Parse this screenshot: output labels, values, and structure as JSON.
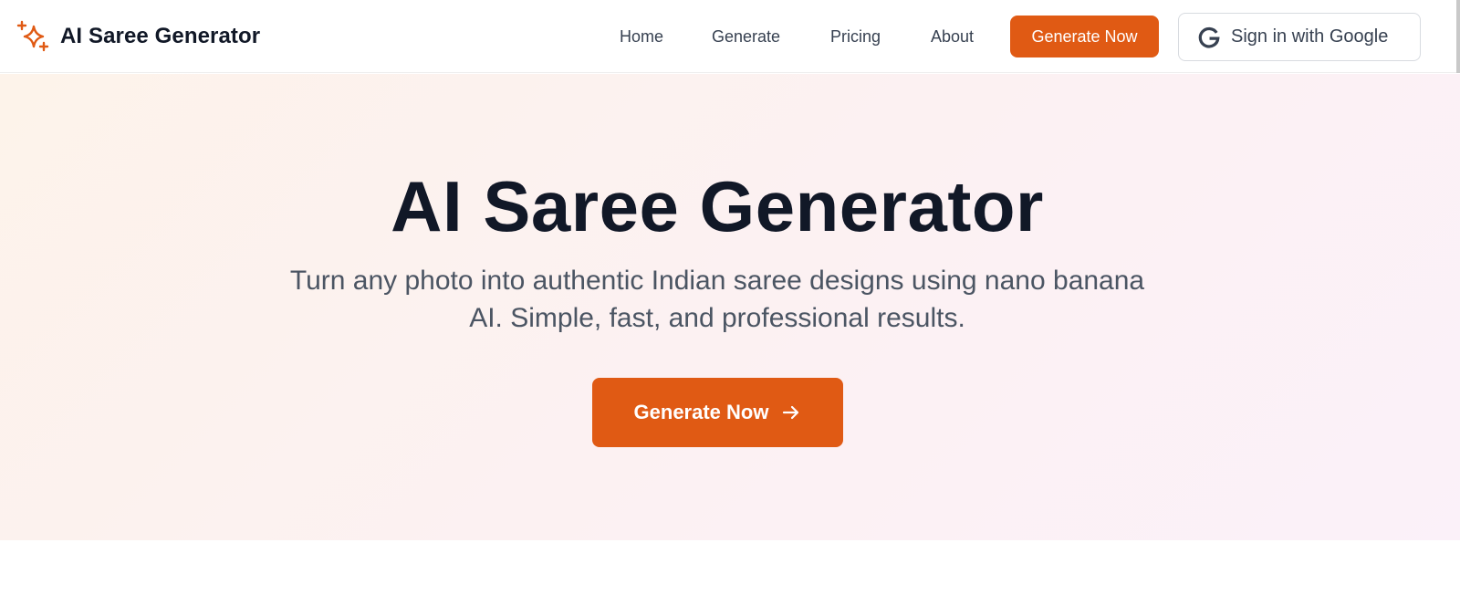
{
  "header": {
    "brand_name": "AI Saree Generator",
    "logo_icon": "sparkles-icon",
    "nav": [
      {
        "label": "Home"
      },
      {
        "label": "Generate"
      },
      {
        "label": "Pricing"
      },
      {
        "label": "About"
      }
    ],
    "cta_label": "Generate Now",
    "google_label": "Sign in with Google",
    "google_icon": "google-icon"
  },
  "hero": {
    "title": "AI Saree Generator",
    "subtitle": "Turn any photo into authentic Indian saree designs using nano banana AI. Simple, fast, and professional results.",
    "cta_label": "Generate Now",
    "cta_icon": "arrow-right-icon"
  },
  "colors": {
    "accent": "#e05a14",
    "heading": "#111827",
    "body_text": "#4b5563",
    "hero_gradient_start": "#fdf3ea",
    "hero_gradient_end": "#fbf1f9"
  }
}
